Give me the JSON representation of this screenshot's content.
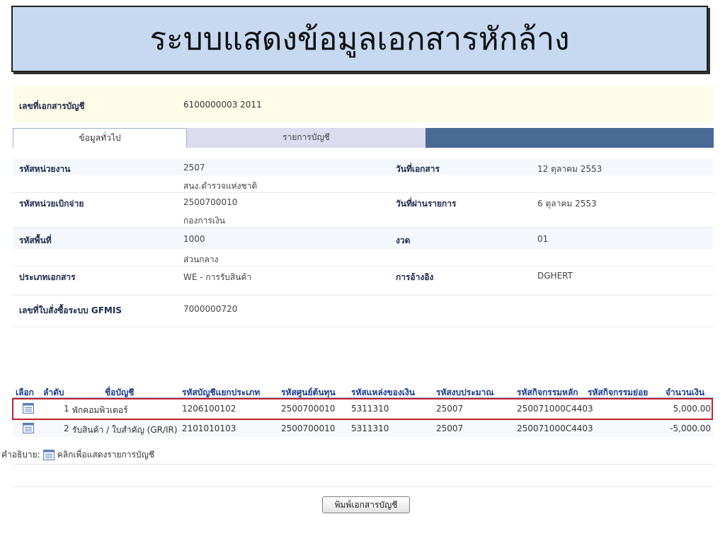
{
  "title": "ระบบแสดงข้อมูลเอกสารหักล้าง",
  "doc_number": {
    "label": "เลขที่เอกสารบัญชี",
    "value": "6100000003  2011"
  },
  "tabs": [
    {
      "label": "ข้อมูลทั่วไป",
      "active": true
    },
    {
      "label": "รายการบัญชี",
      "active": false
    }
  ],
  "general": {
    "unit_code_label": "รหัสหน่วยงาน",
    "unit_code": "2507",
    "unit_name": "สนง.ตำรวจแห่งชาติ",
    "doc_date_label": "วันที่เอกสาร",
    "doc_date": "12 ตุลาคม 2553",
    "disburse_code_label": "รหัสหน่วยเบิกจ่าย",
    "disburse_code": "2500700010",
    "disburse_name": "กองการเงิน",
    "post_date_label": "วันที่ผ่านรายการ",
    "post_date": "6 ตุลาคม 2553",
    "area_code_label": "รหัสพื้นที่",
    "area_code": "1000",
    "area_name": "ส่วนกลาง",
    "period_label": "งวด",
    "period": "01",
    "doc_type_label": "ประเภทเอกสาร",
    "doc_type": "WE - การรับสินค้า",
    "reference_label": "การอ้างอิง",
    "reference": "DGHERT",
    "po_number_label": "เลขที่ใบสั่งซื้อระบบ GFMIS",
    "po_number": "7000000720"
  },
  "accounts": {
    "columns": [
      "เลือก",
      "ลำดับ",
      "ชื่อบัญชี",
      "รหัสบัญชีแยกประเภท",
      "รหัสศูนย์ต้นทุน",
      "รหัสแหล่งของเงิน",
      "รหัสงบประมาณ",
      "รหัสกิจกรรมหลัก",
      "รหัสกิจกรรมย่อย",
      "จำนวนเงิน"
    ],
    "rows": [
      {
        "seq": "1",
        "name": "พักคอมพิวเตอร์",
        "gl": "1206100102",
        "cost_center": "2500700010",
        "fund": "5311310",
        "budget": "25007",
        "activity": "250071000C4403",
        "sub_activity": "",
        "amount": "5,000.00",
        "highlighted": true
      },
      {
        "seq": "2",
        "name": "รับสินค้า / ใบสำคัญ (GR/IR)",
        "gl": "2101010103",
        "cost_center": "2500700010",
        "fund": "5311310",
        "budget": "25007",
        "activity": "250071000C4403",
        "sub_activity": "",
        "amount": "-5,000.00",
        "highlighted": false
      }
    ]
  },
  "legend": {
    "prefix": "คำอธิบาย:",
    "text": "คลิกเพื่อแสดงรายการบัญชี"
  },
  "print_button": "พิมพ์เอกสารบัญชี",
  "icons": {
    "row_select": "document-list-icon"
  },
  "colors": {
    "title_bg": "#c6d9f1",
    "tab_bar": "#4a6a96",
    "header_text": "#1a3a8a",
    "highlight_border": "#c0202a",
    "doc_row_bg": "#fefce8"
  }
}
